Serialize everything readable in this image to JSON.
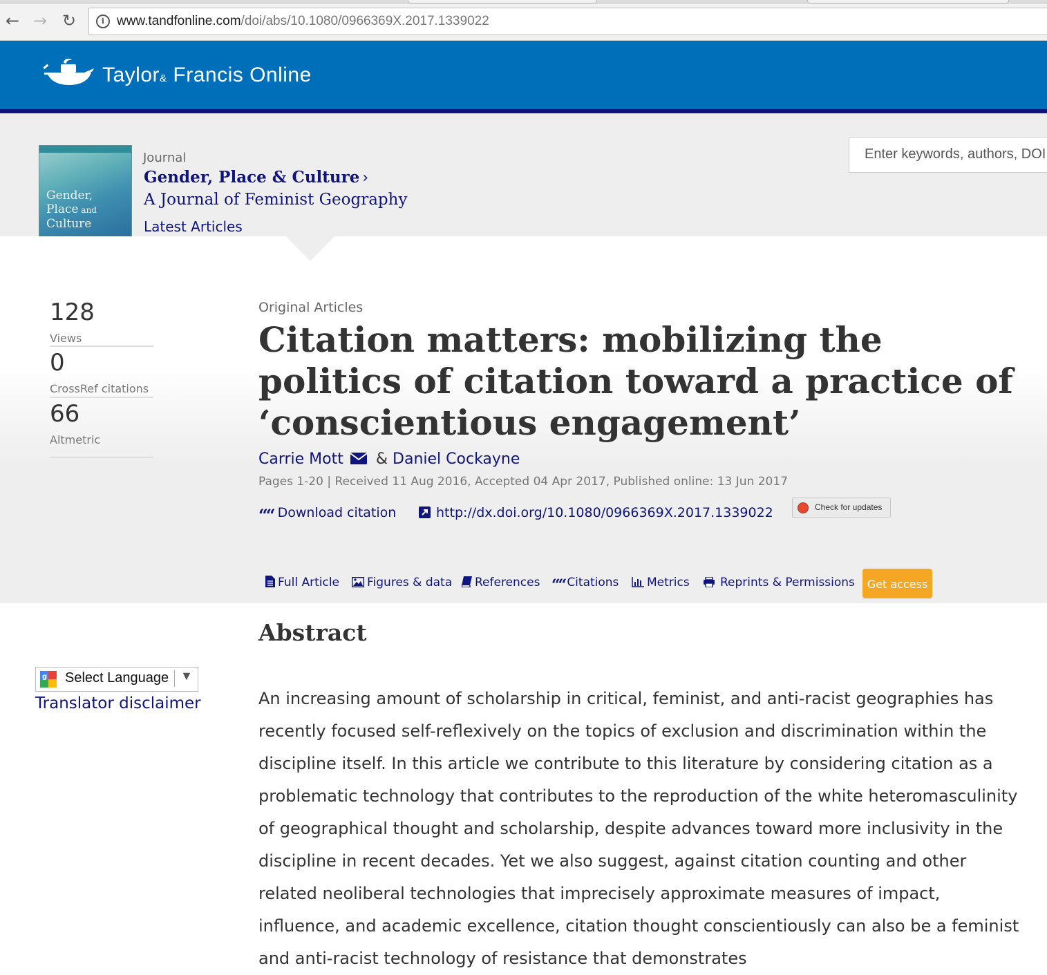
{
  "browser": {
    "url_host": "www.tandfonline.com",
    "url_path": "/doi/abs/10.1080/0966369X.2017.1339022",
    "icons": {
      "back": "arrow-left-icon",
      "forward": "arrow-right-icon",
      "reload": "reload-icon",
      "info": "info-icon"
    }
  },
  "header": {
    "brand_taylor": "Taylor",
    "brand_amp": "&",
    "brand_rest": " Francis Online",
    "color": "#006fba",
    "stripe_color": "#10147e"
  },
  "journal": {
    "label": "Journal",
    "title": "Gender, Place & Culture",
    "chevron": "›",
    "subtitle": "A Journal of Feminist Geography",
    "latest_link": "Latest Articles",
    "cover": {
      "line1": "Gender,",
      "line2_a": "Place",
      "line2_b": " and",
      "line3": "Culture"
    }
  },
  "search": {
    "placeholder": "Enter keywords, authors, DOI etc."
  },
  "metrics": [
    {
      "value": "128",
      "label": "Views"
    },
    {
      "value": "0",
      "label": "CrossRef citations"
    },
    {
      "value": "66",
      "label": "Altmetric"
    }
  ],
  "article": {
    "type": "Original Articles",
    "title": "Citation matters: mobilizing the politics of citation toward a practice of ‘conscientious engagement’",
    "author1": "Carrie Mott",
    "author_sep": " & ",
    "author2": "Daniel Cockayne",
    "pub_info": "Pages 1-20 | Received 11 Aug 2016, Accepted 04 Apr 2017, Published online: 13 Jun 2017",
    "download_citation": "Download citation",
    "doi": "http://dx.doi.org/10.1080/0966369X.2017.1339022",
    "check_updates": "Check for updates"
  },
  "tabs": [
    {
      "label": "Full Article",
      "icon": "document-icon"
    },
    {
      "label": "Figures & data",
      "icon": "image-icon"
    },
    {
      "label": "References",
      "icon": "book-icon"
    },
    {
      "label": "Citations",
      "icon": "quote-icon"
    },
    {
      "label": "Metrics",
      "icon": "bar-chart-icon"
    },
    {
      "label": "Reprints & Permissions",
      "icon": "printer-icon"
    }
  ],
  "get_access": "Get access",
  "accent_color": "#f5a623",
  "link_color": "#10147e",
  "abstract": {
    "heading": "Abstract",
    "text": "An increasing amount of scholarship in critical, feminist, and anti-racist geographies has recently focused self-reflexively on the topics of exclusion and discrimination within the discipline itself. In this article we contribute to this literature by considering citation as a problematic technology that contributes to the reproduction of the white heteromasculinity of geographical thought and scholarship, despite advances toward more inclusivity in the discipline in recent decades. Yet we also suggest, against citation counting and other related neoliberal technologies that imprecisely approximate measures of impact, influence, and academic excellence, citation thought conscientiously can also be a feminist and anti-racist technology of resistance that demonstrates"
  },
  "translate": {
    "select_label": "Select Language",
    "arrow": "▼",
    "disclaimer": "Translator disclaimer"
  }
}
